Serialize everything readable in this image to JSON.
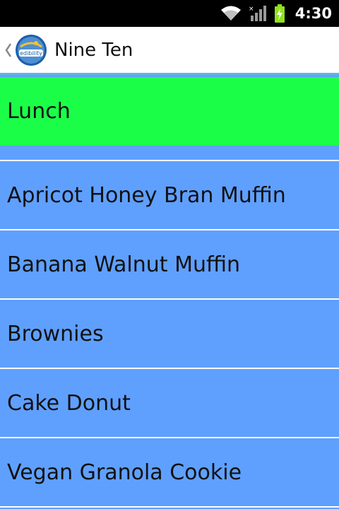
{
  "status_bar": {
    "time": "4:30",
    "icons": [
      "wifi-icon",
      "signal-icon",
      "battery-charging-icon"
    ]
  },
  "action_bar": {
    "title": "Nine Ten",
    "logo_text": "edibility",
    "accent_color": "#5fb4e6"
  },
  "menu": {
    "section_header": "Lunch",
    "items": [
      "Apricot Honey Bran Muffin",
      "Banana Walnut Muffin",
      "Brownies",
      "Cake Donut",
      "Vegan Granola Cookie"
    ]
  },
  "colors": {
    "header_bg": "#1bfe48",
    "list_bg": "#5fa0fe",
    "divider": "#ffffff"
  }
}
